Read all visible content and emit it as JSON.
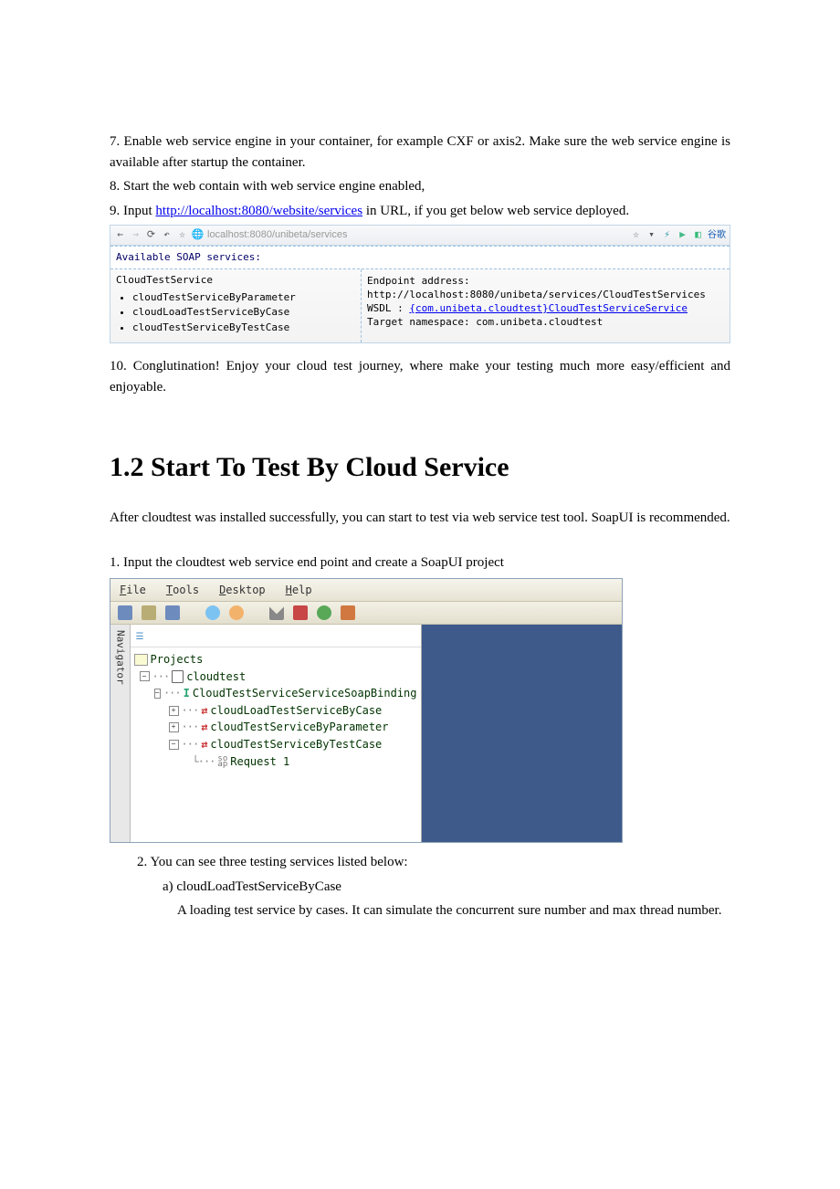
{
  "steps": {
    "s7": "7. Enable web service engine in your container, for example CXF or axis2. Make sure the web service engine is available after startup the container.",
    "s8": "8. Start the web contain with web service engine enabled,",
    "s9_prefix": "9. Input ",
    "s9_link": "http://localhost:8080/website/services",
    "s9_suffix": " in URL, if you get below web service deployed."
  },
  "browser": {
    "url_host": "localhost",
    "url_port_path": ":8080/unibeta/services",
    "soap_header": "Available SOAP services:",
    "service_name": "CloudTestService",
    "ops": [
      "cloudTestServiceByParameter",
      "cloudLoadTestServiceByCase",
      "cloudTestServiceByTestCase"
    ],
    "endpoint_label": "Endpoint address: ",
    "endpoint_value": "http://localhost:8080/unibeta/services/CloudTestServices",
    "wsdl_label": "WSDL : ",
    "wsdl_link": "{com.unibeta.cloudtest}CloudTestServiceService",
    "tns_label": "Target namespace: ",
    "tns_value": "com.unibeta.cloudtest",
    "brand": "谷歌"
  },
  "step10": "10. Conglutination! Enjoy your cloud test journey, where make your testing much more easy/efficient and enjoyable.",
  "heading": "1.2 Start To Test By Cloud Service",
  "after_intro": "After cloudtest was installed successfully, you can start to test via web service test tool. SoapUI is recommended.",
  "sub_step1": "1. Input the cloudtest web service end point and create a SoapUI project",
  "soapui": {
    "menus": [
      "File",
      "Tools",
      "Desktop",
      "Help"
    ],
    "side_label": "Navigator",
    "tree": {
      "root": "Projects",
      "project": "cloudtest",
      "binding": "CloudTestServiceServiceSoapBinding",
      "ops": [
        "cloudLoadTestServiceByCase",
        "cloudTestServiceByParameter",
        "cloudTestServiceByTestCase"
      ],
      "request": "Request 1"
    }
  },
  "sub_step2": "2.   You can see three testing services listed below:",
  "sub_step2a": "a)    cloudLoadTestServiceByCase",
  "sub_step2a_desc": "A loading test service by cases. It can simulate the concurrent sure number and max thread number."
}
